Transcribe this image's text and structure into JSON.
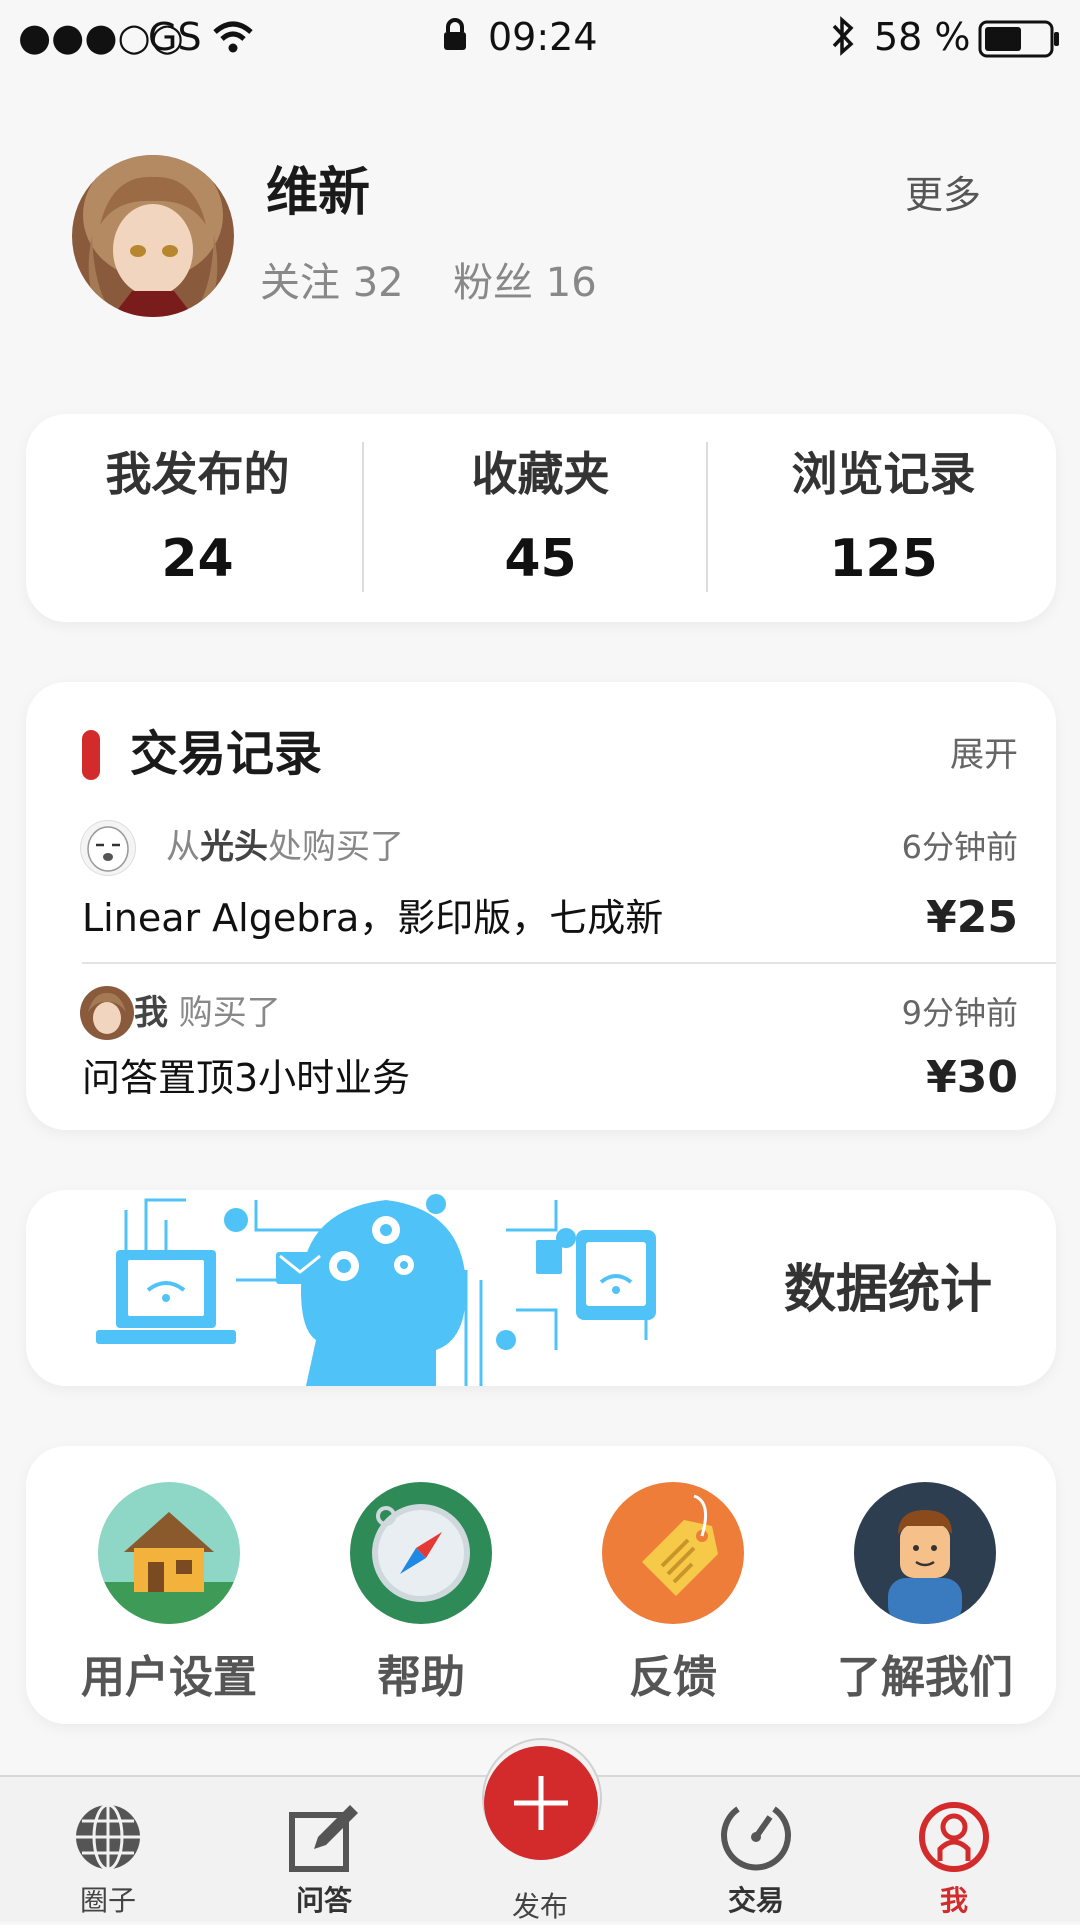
{
  "status_bar": {
    "signal": "●●●○○",
    "carrier": "GS",
    "time": "09:24",
    "battery": "58 %"
  },
  "profile": {
    "name": "维新",
    "follow_label": "关注",
    "follow_count": "32",
    "fans_label": "粉丝",
    "fans_count": "16",
    "more": "更多"
  },
  "stats": [
    {
      "label": "我发布的",
      "value": "24"
    },
    {
      "label": "收藏夹",
      "value": "45"
    },
    {
      "label": "浏览记录",
      "value": "125"
    }
  ],
  "trades": {
    "title": "交易记录",
    "expand": "展开",
    "rows": [
      {
        "prefix": "从",
        "who": "光头",
        "suffix": "处购买了",
        "time": "6分钟前",
        "item": "Linear Algebra，影印版，七成新",
        "price": "¥25"
      },
      {
        "prefix": "",
        "who": "我",
        "suffix": " 购买了",
        "time": "9分钟前",
        "item": "问答置顶3小时业务",
        "price": "¥30"
      }
    ]
  },
  "data_banner": {
    "title": "数据统计"
  },
  "menu": [
    {
      "label": "用户设置",
      "icon": "house-icon"
    },
    {
      "label": "帮助",
      "icon": "compass-icon"
    },
    {
      "label": "反馈",
      "icon": "tag-icon"
    },
    {
      "label": "了解我们",
      "icon": "person-icon"
    }
  ],
  "tabs": [
    {
      "label": "圈子",
      "icon": "globe-icon"
    },
    {
      "label": "问答",
      "icon": "edit-icon"
    },
    {
      "label": "发布",
      "icon": "plus-icon"
    },
    {
      "label": "交易",
      "icon": "gauge-icon"
    },
    {
      "label": "我",
      "icon": "user-ring-icon",
      "active": true
    }
  ],
  "colors": {
    "accent": "#d32b2b",
    "banner_blue": "#4fc3f7"
  }
}
